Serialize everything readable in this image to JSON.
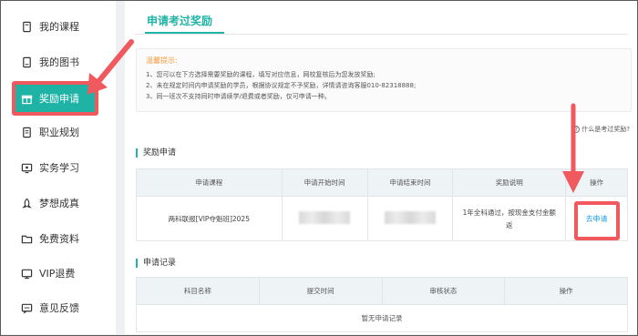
{
  "sidebar": {
    "items": [
      {
        "label": "我的课程",
        "icon": "document-icon"
      },
      {
        "label": "我的图书",
        "icon": "book-icon"
      },
      {
        "label": "奖励申请",
        "icon": "gift-icon",
        "active": true
      },
      {
        "label": "职业规划",
        "icon": "file-icon"
      },
      {
        "label": "实务学习",
        "icon": "monitor-icon"
      },
      {
        "label": "梦想成真",
        "icon": "rocket-icon"
      },
      {
        "label": "免费资料",
        "icon": "folder-icon"
      },
      {
        "label": "VIP退费",
        "icon": "screen-icon"
      },
      {
        "label": "意见反馈",
        "icon": "chat-icon"
      }
    ]
  },
  "main": {
    "tab_title": "申请考过奖励",
    "tips": {
      "title": "温馨提示:",
      "lines": [
        "1、您可以在下方选择需要奖励的课程，填写对应信息，网校复核后为您发放奖励;",
        "2、未在规定时间内申请奖励的学员，根据协议规定不予奖励，详情请咨询客服010-82318888;",
        "3、同一班次不支持同时申请续学/退费或者奖励，仅可申请一种。"
      ]
    },
    "help_link": "什么是考过奖励?",
    "award_section": {
      "title": "奖励申请",
      "headers": [
        "申请课程",
        "申请开始时间",
        "申请结束时间",
        "奖励说明",
        "操作"
      ],
      "row": {
        "course": "两科联报[VIP夺魁班]2025",
        "description_line1": "1年全科通过，按现金支付金额",
        "description_line2": "返",
        "action": "去申请"
      }
    },
    "record_section": {
      "title": "申请记录",
      "headers": [
        "科目名称",
        "提交时间",
        "审核状态",
        "操作"
      ],
      "empty": "暂无申请记录"
    }
  },
  "colors": {
    "accent": "#1fb3a6",
    "highlight": "#f05a5e",
    "link": "#1f9de0",
    "tips_title": "#f59b3d"
  }
}
